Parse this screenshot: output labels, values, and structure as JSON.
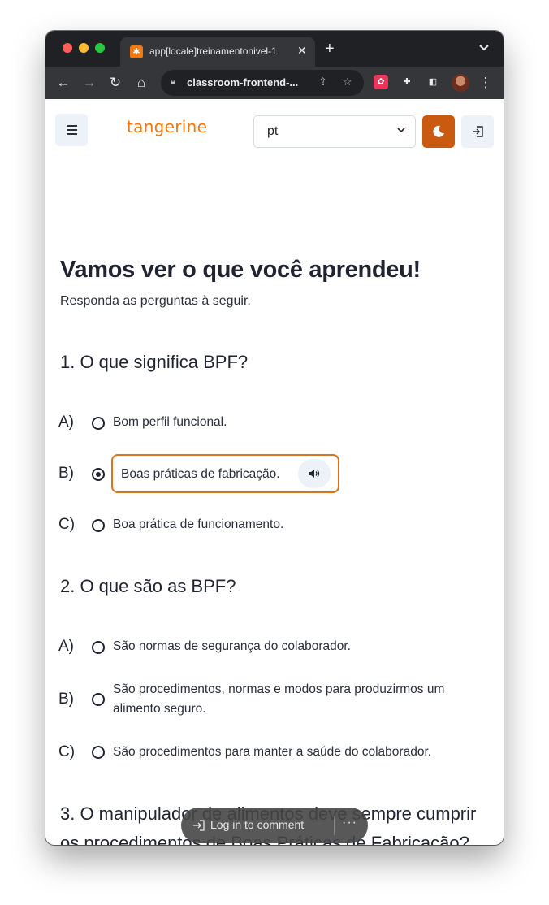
{
  "browser": {
    "tab_title": "app[locale]treinamentonivel-1",
    "url": "classroom-frontend-...",
    "new_tab_icon": "plus-icon",
    "colors": {
      "titlebar": "#202124",
      "toolbar": "#35363a"
    }
  },
  "header": {
    "logo": "tangerine",
    "language_value": "pt",
    "colors": {
      "brand": "#f07a12",
      "theme_button": "#c95a10"
    }
  },
  "main": {
    "heading": "Vamos ver o que você aprendeu!",
    "subheading": "Responda as perguntas à seguir."
  },
  "questions": [
    {
      "text": "1. O que significa BPF?",
      "options": [
        {
          "letter": "A)",
          "text": "Bom perfil funcional.",
          "selected": false
        },
        {
          "letter": "B)",
          "text": "Boas práticas de fabricação.",
          "selected": true
        },
        {
          "letter": "C)",
          "text": "Boa prática de funcionamento.",
          "selected": false
        }
      ]
    },
    {
      "text": "2. O que são as BPF?",
      "options": [
        {
          "letter": "A)",
          "text": "São normas de segurança do colaborador.",
          "selected": false
        },
        {
          "letter": "B)",
          "text": "São procedimentos, normas e modos para produzirmos um alimento seguro.",
          "selected": false
        },
        {
          "letter": "C)",
          "text": "São procedimentos para manter a saúde do colaborador.",
          "selected": false
        }
      ]
    },
    {
      "text": "3. O manipulador de alimentos deve sempre cumprir os procedimentos de Boas Práticas de Fabricação?"
    }
  ],
  "comment_bar": {
    "label": "Log in to comment",
    "more": "···"
  }
}
